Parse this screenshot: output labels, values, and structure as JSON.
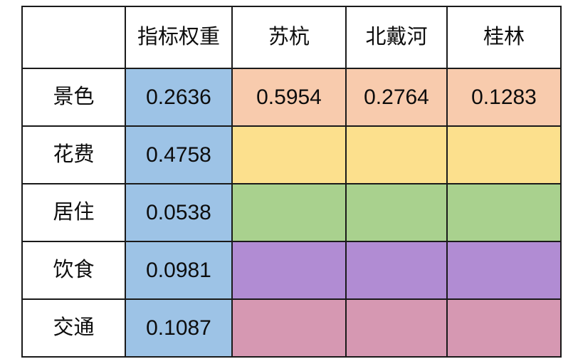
{
  "table": {
    "headers": [
      "",
      "指标权重",
      "苏杭",
      "北戴河",
      "桂林"
    ],
    "rows": [
      {
        "label": "景色",
        "weight": "0.2636",
        "values": [
          "0.5954",
          "0.2764",
          "0.1283"
        ],
        "band_color": "#F8CBAD"
      },
      {
        "label": "花费",
        "weight": "0.4758",
        "values": [
          "",
          "",
          ""
        ],
        "band_color": "#FCE08D"
      },
      {
        "label": "居住",
        "weight": "0.0538",
        "values": [
          "",
          "",
          ""
        ],
        "band_color": "#A9D18E"
      },
      {
        "label": "饮食",
        "weight": "0.0981",
        "values": [
          "",
          "",
          ""
        ],
        "band_color": "#B18CD3"
      },
      {
        "label": "交通",
        "weight": "0.1087",
        "values": [
          "",
          "",
          ""
        ],
        "band_color": "#D698B2"
      }
    ],
    "colors": {
      "weight_column": "#9DC3E6",
      "label_column": "#FFFFFF",
      "header": "#FFFFFF",
      "border": "#1A1A1A",
      "text": "#0D0D0D"
    }
  }
}
